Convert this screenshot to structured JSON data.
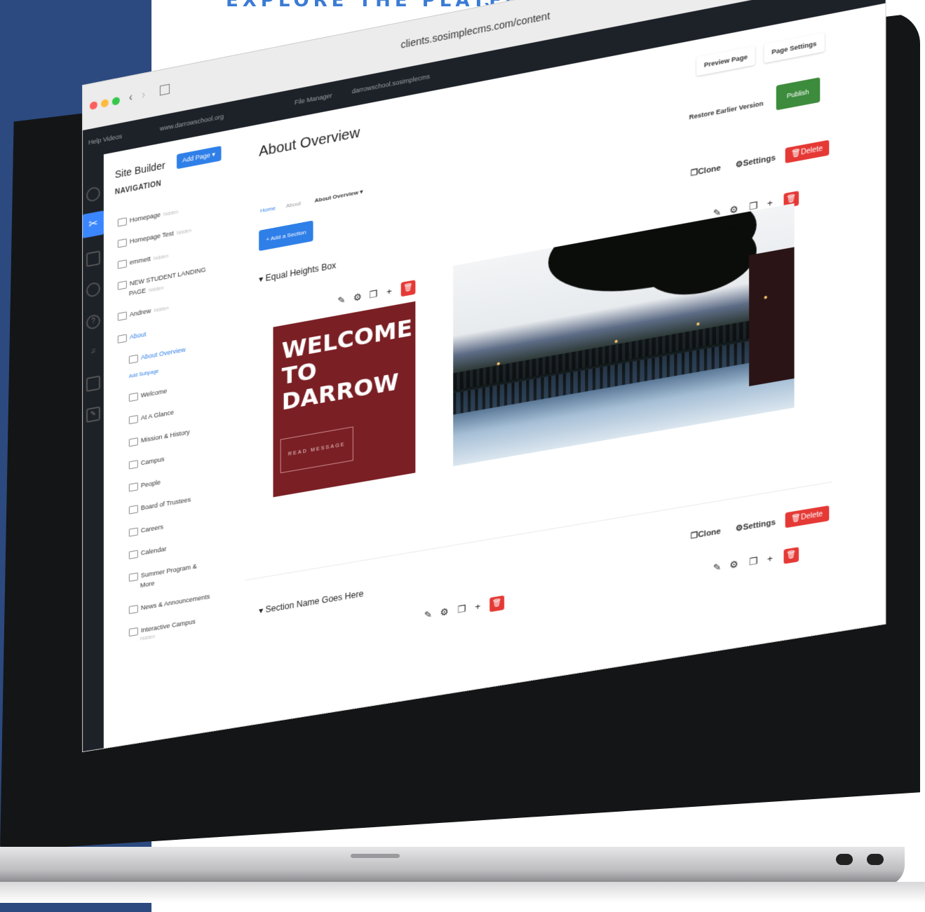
{
  "headline": {
    "text": "EXPLORE THE PLATFORM",
    "arrow": "›"
  },
  "browser": {
    "url": "clients.sosimplecms.com/content",
    "reload_icon": "reload-icon",
    "toolbar_icons": [
      "download-icon",
      "share-icon",
      "tabs-icon",
      "new-tab-icon"
    ]
  },
  "topnav": {
    "left": "Help Videos",
    "items": [
      "www.darrowschool.org",
      "File Manager",
      "darrowschool.sosimplecms"
    ]
  },
  "sidebar_icons": [
    "dashboard-icon",
    "site-builder-icon",
    "trash-icon",
    "user-icon",
    "help-icon",
    "music-icon",
    "archive-icon",
    "edit-icon"
  ],
  "navpanel": {
    "title": "Site Builder",
    "add_page": "Add Page ▾",
    "label": "NAVIGATION",
    "items": [
      {
        "label": "Homepage",
        "tag": "hidden"
      },
      {
        "label": "Homepage Test",
        "tag": "hidden"
      },
      {
        "label": "emmett",
        "tag": "hidden"
      },
      {
        "label": "NEW STUDENT LANDING",
        "tag": ""
      },
      {
        "label": "PAGE",
        "tag": "hidden"
      },
      {
        "label": "Andrew",
        "tag": "hidden"
      },
      {
        "label": "About",
        "tag": ""
      },
      {
        "label": "About Overview",
        "tag": ""
      },
      {
        "label": "Add Subpage",
        "tag": ""
      },
      {
        "label": "Welcome",
        "tag": ""
      },
      {
        "label": "At A Glance",
        "tag": ""
      },
      {
        "label": "Mission & History",
        "tag": ""
      },
      {
        "label": "Campus",
        "tag": ""
      },
      {
        "label": "People",
        "tag": ""
      },
      {
        "label": "Board of Trustees",
        "tag": ""
      },
      {
        "label": "Careers",
        "tag": ""
      },
      {
        "label": "Calendar",
        "tag": ""
      },
      {
        "label": "Summer Program &",
        "tag": ""
      },
      {
        "label": "More",
        "tag": ""
      },
      {
        "label": "News & Announcements",
        "tag": ""
      },
      {
        "label": "Interactive Campus",
        "tag": ""
      },
      {
        "label": "hidden",
        "tag": ""
      }
    ]
  },
  "main": {
    "title": "About Overview",
    "preview": "Preview Page",
    "page_settings": "Page Settings",
    "restore": "Restore Earlier Version",
    "publish": "Publish",
    "breadcrumb": [
      "Home",
      "About",
      "About Overview ▾"
    ],
    "add_section": "+ Add a Section",
    "section1": {
      "title": "Equal Heights Box",
      "clone": "Clone",
      "settings": "Settings",
      "delete": "Delete"
    },
    "section2": {
      "title": "Section Name Goes Here",
      "clone": "Clone",
      "settings": "Settings",
      "delete": "Delete"
    },
    "welcome": {
      "text": "WELCOME TO DARROW",
      "button": "READ MESSAGE"
    }
  },
  "colors": {
    "accent": "#2f7fe8",
    "publish": "#3d8b3d",
    "delete": "#e53935",
    "welcome_bg": "#7a1f24",
    "page_bg_left": "#2c4a80"
  }
}
